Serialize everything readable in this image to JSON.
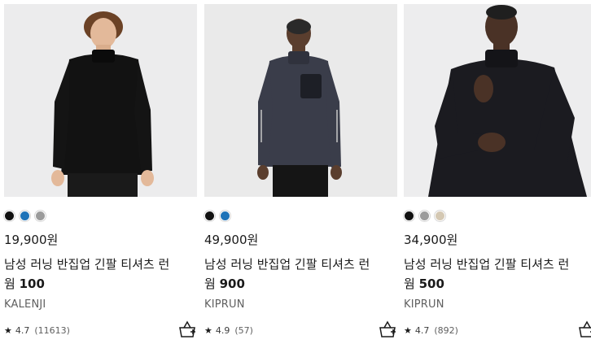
{
  "products": [
    {
      "price": "19,900원",
      "title_line1": "남성 러닝 반집업 긴팔 티셔츠 런",
      "title_prefix": "웜 ",
      "title_model": "100",
      "brand": "KALENJI",
      "rating": "4.7",
      "reviews": "(11613)",
      "swatches": [
        "#111111",
        "#1e73b8",
        "#9b9b9b"
      ],
      "shirt_color": "#121212",
      "image_alt": "Man wearing black half-zip running shirt"
    },
    {
      "price": "49,900원",
      "title_line1": "남성 러닝 반집업 긴팔 티셔츠 런",
      "title_prefix": "웜 ",
      "title_model": "900",
      "brand": "KIPRUN",
      "rating": "4.9",
      "reviews": "(57)",
      "swatches": [
        "#111111",
        "#1e73b8"
      ],
      "shirt_color": "#3a3d4a",
      "image_alt": "Man wearing dark grey half-zip running shirt"
    },
    {
      "price": "34,900원",
      "title_line1": "남성 러닝 반집업 긴팔 티셔츠 런",
      "title_prefix": "웜 ",
      "title_model": "500",
      "brand": "KIPRUN",
      "rating": "4.7",
      "reviews": "(892)",
      "swatches": [
        "#111111",
        "#9b9b9b",
        "#d4c8b3"
      ],
      "shirt_color": "#1b1b20",
      "image_alt": "Man zipping up black half-zip running shirt"
    }
  ],
  "icons": {
    "star": "★",
    "basket": "add-to-basket-icon"
  }
}
